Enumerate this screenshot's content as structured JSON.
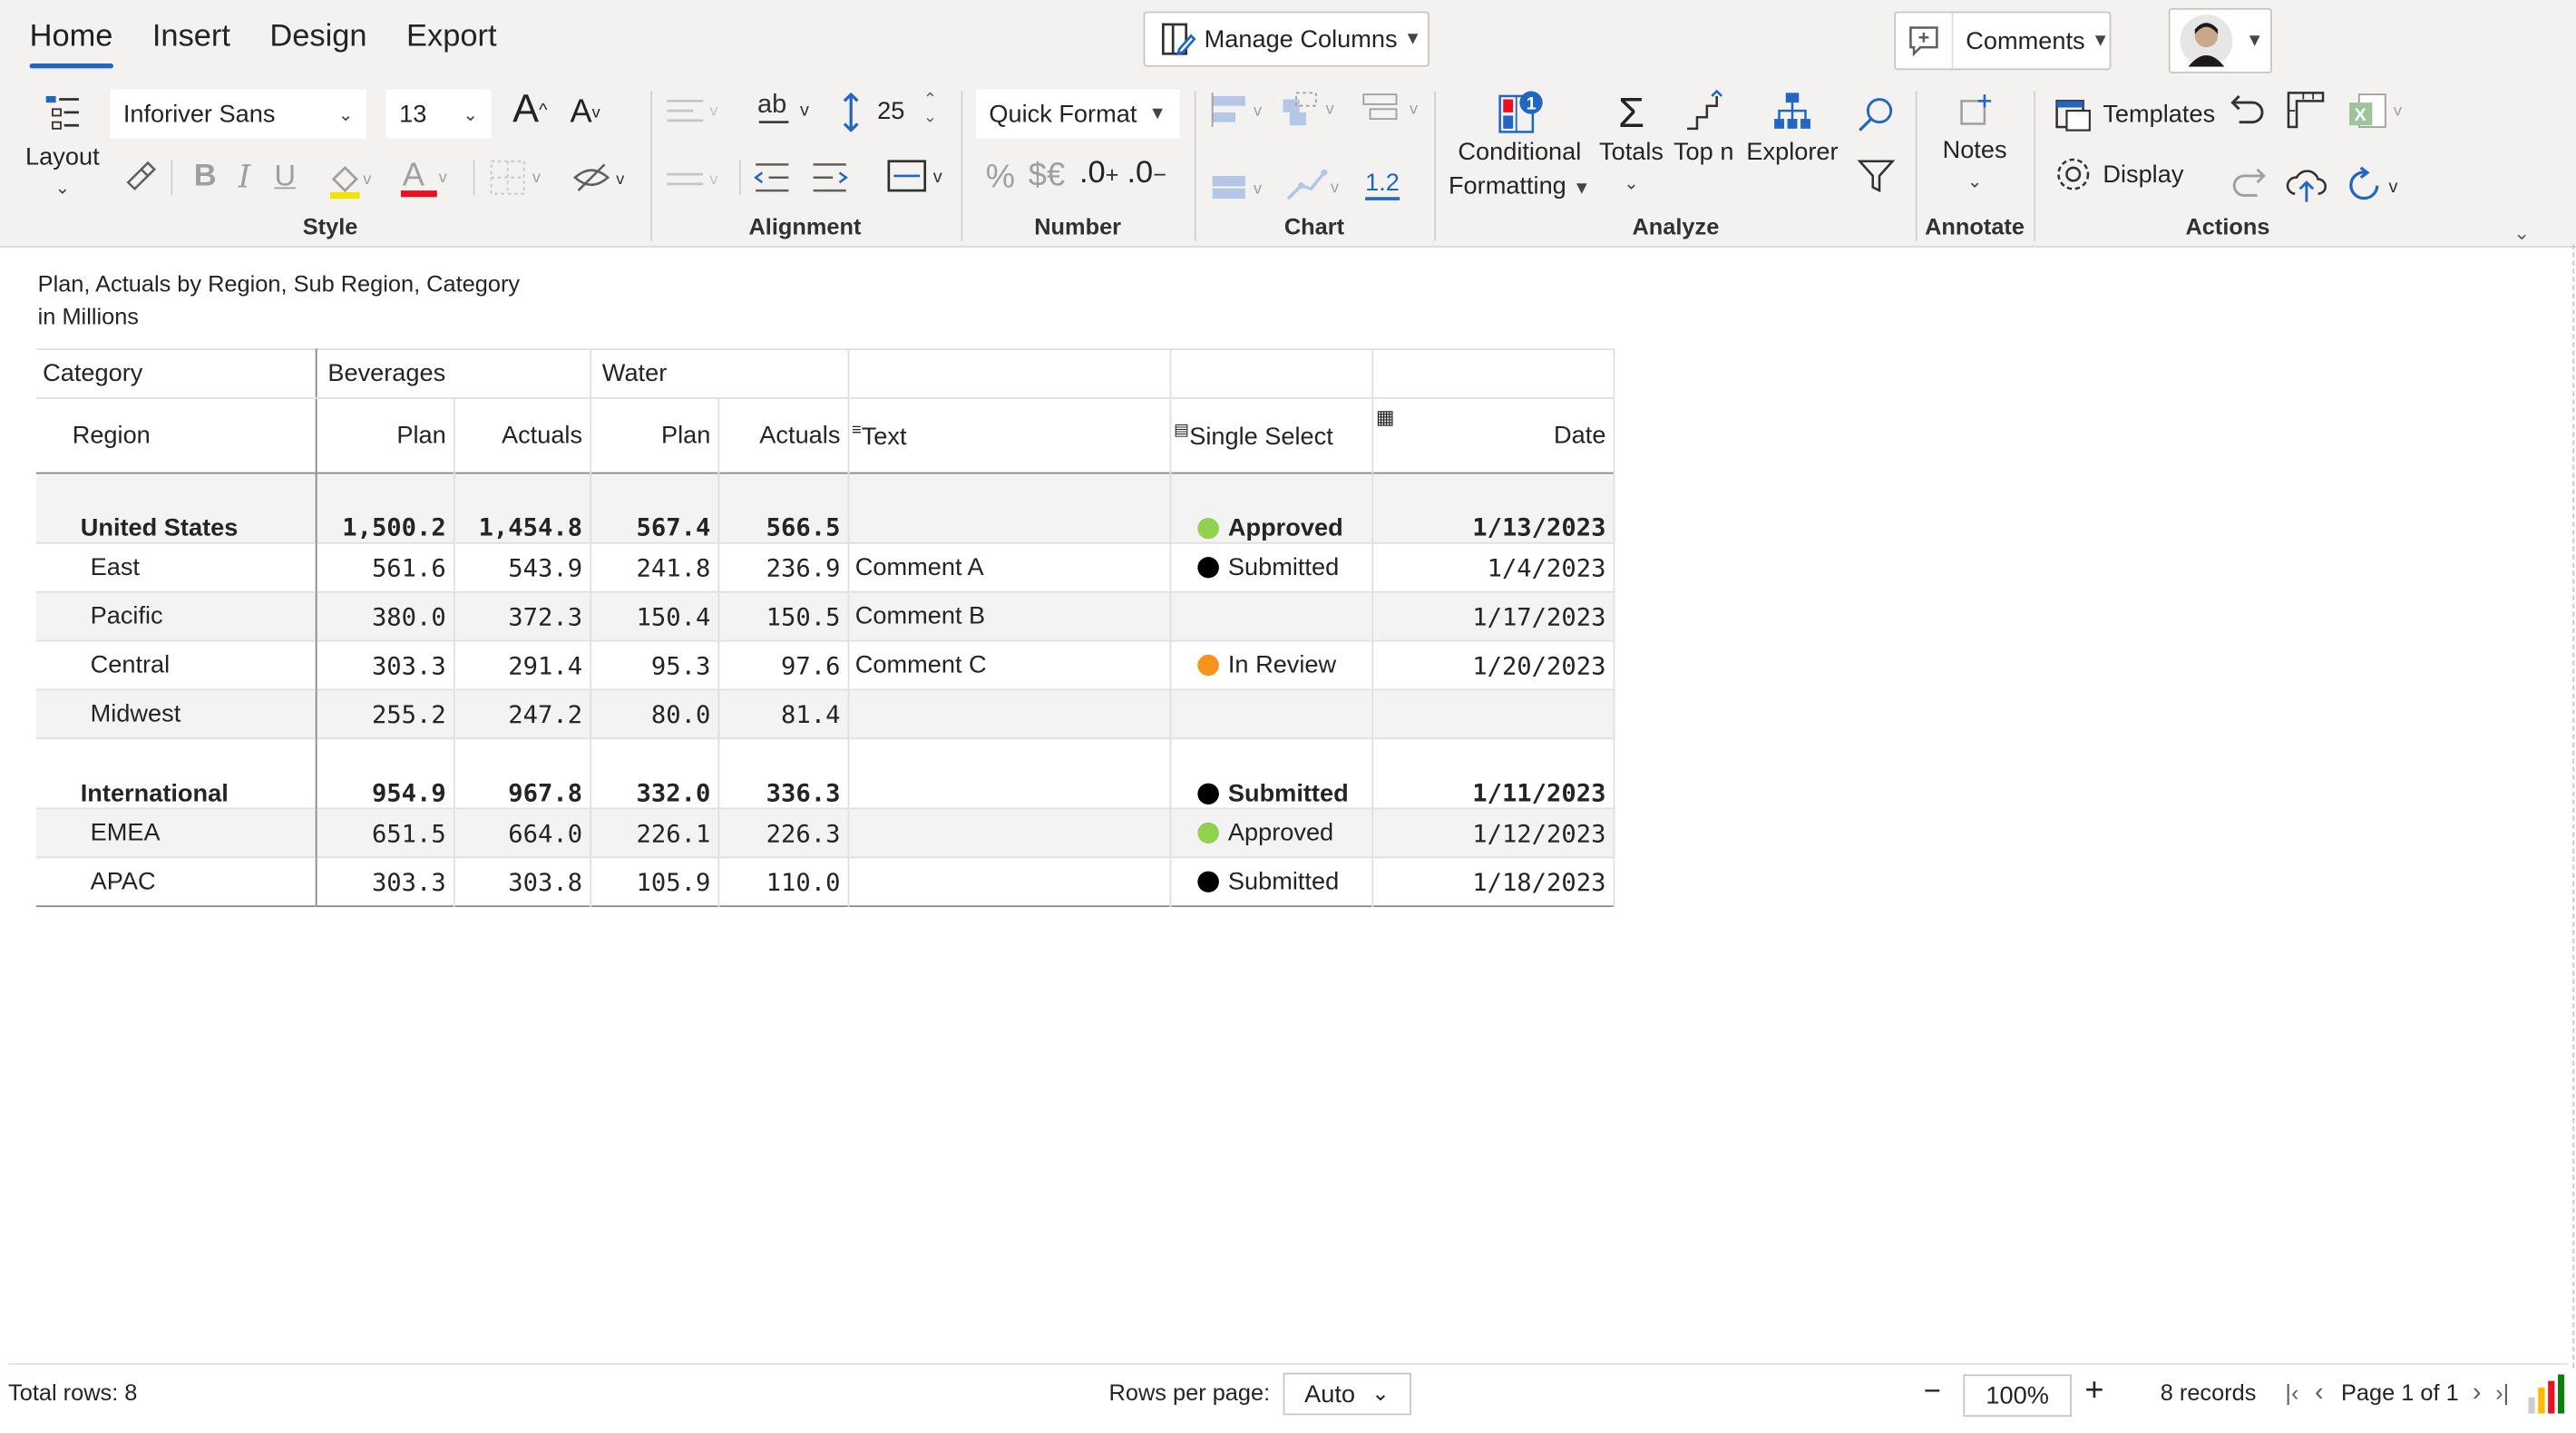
{
  "ribbon": {
    "tabs": [
      {
        "label": "Home",
        "active": true
      },
      {
        "label": "Insert"
      },
      {
        "label": "Design"
      },
      {
        "label": "Export"
      }
    ],
    "manage_columns": "Manage Columns",
    "comments": "Comments",
    "style": {
      "label": "Style",
      "layout": "Layout",
      "font_family": "Inforiver Sans",
      "font_size": "13"
    },
    "alignment": {
      "label": "Alignment",
      "row_height": "25"
    },
    "number": {
      "label": "Number",
      "quick_format": "Quick Format",
      "percent": "%",
      "currency": "$€",
      "inc_decimal": ".0",
      "dec_decimal": ".0"
    },
    "chart": {
      "label": "Chart",
      "value_label": "1.2"
    },
    "analyze": {
      "label": "Analyze",
      "conditional_formatting_line1": "Conditional",
      "conditional_formatting_line2": "Formatting",
      "cf_badge": "1",
      "totals": "Totals",
      "top_n": "Top n",
      "explorer": "Explorer"
    },
    "annotate": {
      "label": "Annotate",
      "notes": "Notes"
    },
    "actions": {
      "label": "Actions",
      "templates": "Templates",
      "display": "Display"
    }
  },
  "report": {
    "title": "Plan, Actuals by Region, Sub Region, Category",
    "subtitle": "in Millions"
  },
  "table": {
    "category_header": "Category",
    "region_header": "Region",
    "groups": [
      "Beverages",
      "Water"
    ],
    "measure_headers": [
      "Plan",
      "Actuals",
      "Plan",
      "Actuals"
    ],
    "text_header": "Text",
    "select_header": "Single Select",
    "date_header": "Date",
    "rows": [
      {
        "label": "United States",
        "level": 0,
        "vals": [
          "1,500.2",
          "1,454.8",
          "567.4",
          "566.5"
        ],
        "text": "",
        "status": "Approved",
        "status_color": "#92d050",
        "date": "1/13/2023"
      },
      {
        "label": "East",
        "level": 1,
        "vals": [
          "561.6",
          "543.9",
          "241.8",
          "236.9"
        ],
        "text": "Comment A",
        "status": "Submitted",
        "status_color": "#000000",
        "date": "1/4/2023"
      },
      {
        "label": "Pacific",
        "level": 1,
        "vals": [
          "380.0",
          "372.3",
          "150.4",
          "150.5"
        ],
        "text": "Comment B",
        "status": "",
        "status_color": "",
        "date": "1/17/2023"
      },
      {
        "label": "Central",
        "level": 1,
        "vals": [
          "303.3",
          "291.4",
          "95.3",
          "97.6"
        ],
        "text": "Comment C",
        "status": "In Review",
        "status_color": "#f7941d",
        "date": "1/20/2023"
      },
      {
        "label": "Midwest",
        "level": 1,
        "vals": [
          "255.2",
          "247.2",
          "80.0",
          "81.4"
        ],
        "text": "",
        "status": "",
        "status_color": "",
        "date": ""
      },
      {
        "label": "International",
        "level": 0,
        "vals": [
          "954.9",
          "967.8",
          "332.0",
          "336.3"
        ],
        "text": "",
        "status": "Submitted",
        "status_color": "#000000",
        "date": "1/11/2023"
      },
      {
        "label": "EMEA",
        "level": 1,
        "vals": [
          "651.5",
          "664.0",
          "226.1",
          "226.3"
        ],
        "text": "",
        "status": "Approved",
        "status_color": "#92d050",
        "date": "1/12/2023"
      },
      {
        "label": "APAC",
        "level": 1,
        "vals": [
          "303.3",
          "303.8",
          "105.9",
          "110.0"
        ],
        "text": "",
        "status": "Submitted",
        "status_color": "#000000",
        "date": "1/18/2023"
      }
    ]
  },
  "footer": {
    "total_rows": "Total rows: 8",
    "rows_per_page_label": "Rows per page:",
    "rows_per_page_value": "Auto",
    "zoom": "100%",
    "records": "8 records",
    "page_label": "Page 1 of 1"
  },
  "colors": {
    "accent": "#2266c2",
    "approved": "#92d050",
    "in_review": "#f7941d",
    "submitted": "#000000"
  }
}
